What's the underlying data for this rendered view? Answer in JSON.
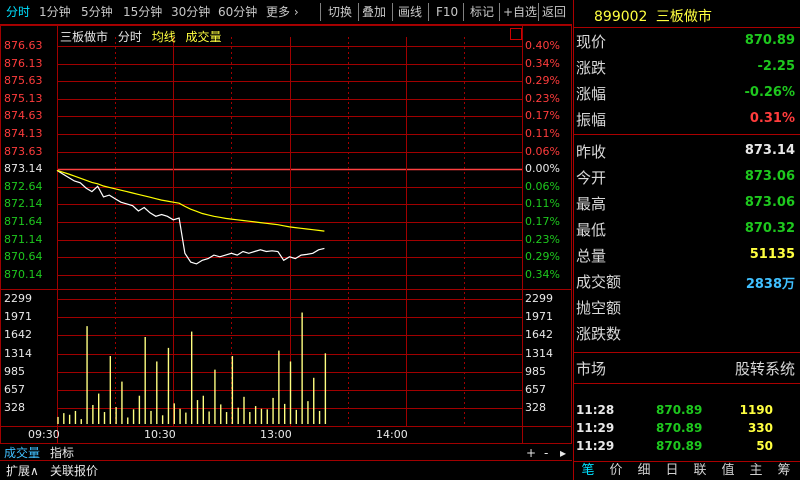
{
  "toolbar": {
    "periods": [
      "分时",
      "1分钟",
      "5分钟",
      "15分钟",
      "30分钟",
      "60分钟",
      "更多 ›"
    ],
    "actions": [
      "切换",
      "叠加",
      "画线",
      "F10",
      "标记",
      "+自选",
      "返回"
    ]
  },
  "chart": {
    "legend": {
      "name": "三板做市",
      "mode": "分时",
      "avg_label": "均线",
      "vol_label": "成交量"
    },
    "price_labels": [
      "876.63",
      "876.13",
      "875.63",
      "875.13",
      "874.63",
      "874.13",
      "873.63",
      "873.14",
      "872.64",
      "872.14",
      "871.64",
      "871.14",
      "870.64",
      "870.14"
    ],
    "pct_labels": [
      "0.40%",
      "0.34%",
      "0.29%",
      "0.23%",
      "0.17%",
      "0.11%",
      "0.06%",
      "0.00%",
      "0.06%",
      "0.11%",
      "0.17%",
      "0.23%",
      "0.29%",
      "0.34%"
    ],
    "volume_labels": [
      "2299",
      "1971",
      "1642",
      "1314",
      "985",
      "657",
      "328"
    ],
    "time_labels": [
      "09:30",
      "10:30",
      "13:00",
      "14:00"
    ],
    "bottom_tabs": [
      "成交量",
      "指标"
    ],
    "bottom_controls": [
      "+",
      "-",
      "▸"
    ],
    "footer_tabs": [
      "扩展∧",
      "关联报价"
    ]
  },
  "chart_data": {
    "type": "line",
    "prev_close": 873.14,
    "ylim": [
      870.14,
      876.63
    ],
    "x": [
      0,
      3,
      6,
      9,
      12,
      15,
      18,
      21,
      24,
      27,
      30,
      33,
      36,
      39,
      42,
      45,
      48,
      51,
      54,
      57,
      60,
      63,
      66,
      69,
      72,
      75,
      78,
      81,
      84,
      87,
      90,
      93,
      96,
      99,
      102,
      105,
      108,
      111,
      114,
      117,
      120,
      123,
      126,
      129,
      132,
      135,
      138
    ],
    "series": [
      {
        "name": "分时",
        "values": [
          873.1,
          873.0,
          872.9,
          872.8,
          872.75,
          872.6,
          872.5,
          872.65,
          872.35,
          872.4,
          872.3,
          872.2,
          872.15,
          872.1,
          871.95,
          872.05,
          871.9,
          871.8,
          871.85,
          871.8,
          871.7,
          871.75,
          870.75,
          870.5,
          870.45,
          870.55,
          870.6,
          870.7,
          870.65,
          870.7,
          870.75,
          870.7,
          870.8,
          870.75,
          870.8,
          870.85,
          870.8,
          870.82,
          870.8,
          870.55,
          870.65,
          870.6,
          870.7,
          870.72,
          870.75,
          870.85,
          870.89
        ]
      },
      {
        "name": "均线",
        "values": [
          873.1,
          873.05,
          873.0,
          872.94,
          872.88,
          872.82,
          872.76,
          872.72,
          872.66,
          872.62,
          872.58,
          872.54,
          872.5,
          872.46,
          872.42,
          872.38,
          872.34,
          872.3,
          872.26,
          872.23,
          872.2,
          872.17,
          872.08,
          872.0,
          871.94,
          871.88,
          871.84,
          871.8,
          871.77,
          871.74,
          871.72,
          871.7,
          871.68,
          871.66,
          871.64,
          871.62,
          871.6,
          871.58,
          871.56,
          871.53,
          871.5,
          871.48,
          871.46,
          871.44,
          871.42,
          871.4,
          871.38
        ]
      }
    ],
    "volume": [
      130,
      200,
      170,
      240,
      90,
      1800,
      350,
      560,
      220,
      1250,
      310,
      780,
      120,
      270,
      520,
      1600,
      240,
      1150,
      160,
      1400,
      380,
      280,
      210,
      1700,
      440,
      520,
      230,
      1000,
      360,
      220,
      1250,
      300,
      500,
      220,
      330,
      280,
      270,
      480,
      1350,
      370,
      1150,
      260,
      2050,
      420,
      850,
      240,
      1300
    ],
    "vol_ylim": [
      0,
      2299
    ]
  },
  "panel": {
    "code": "899002",
    "name": "三板做市",
    "quote1": [
      {
        "label": "现价",
        "value": "870.89",
        "color": "green"
      },
      {
        "label": "涨跌",
        "value": "-2.25",
        "color": "green"
      },
      {
        "label": "涨幅",
        "value": "-0.26%",
        "color": "green"
      },
      {
        "label": "振幅",
        "value": "0.31%",
        "color": "red"
      }
    ],
    "quote2": [
      {
        "label": "昨收",
        "value": "873.14",
        "color": "white"
      },
      {
        "label": "今开",
        "value": "873.06",
        "color": "green"
      },
      {
        "label": "最高",
        "value": "873.06",
        "color": "green"
      },
      {
        "label": "最低",
        "value": "870.32",
        "color": "green"
      },
      {
        "label": "总量",
        "value": "51135",
        "color": "yellow"
      },
      {
        "label": "成交额",
        "value": "2838万",
        "color": "cyan"
      },
      {
        "label": "抛空额",
        "value": "",
        "color": "white"
      },
      {
        "label": "涨跌数",
        "value": "",
        "color": "white"
      }
    ],
    "market_label": "市场",
    "market_value": "股转系统",
    "ticks": [
      {
        "time": "11:28",
        "price": "870.89",
        "vol": "1190"
      },
      {
        "time": "11:29",
        "price": "870.89",
        "vol": "330"
      },
      {
        "time": "11:29",
        "price": "870.89",
        "vol": "50"
      }
    ],
    "bottom_tabs": [
      "笔",
      "价",
      "细",
      "日",
      "联",
      "值",
      "主",
      "筹"
    ]
  },
  "colors": {
    "grid_red": "#a00000",
    "price_line": "#ffffff",
    "avg_line": "#ffff00",
    "volume_bar": "#ffff80",
    "up": "#ff3c3c",
    "down": "#1ec81e"
  }
}
